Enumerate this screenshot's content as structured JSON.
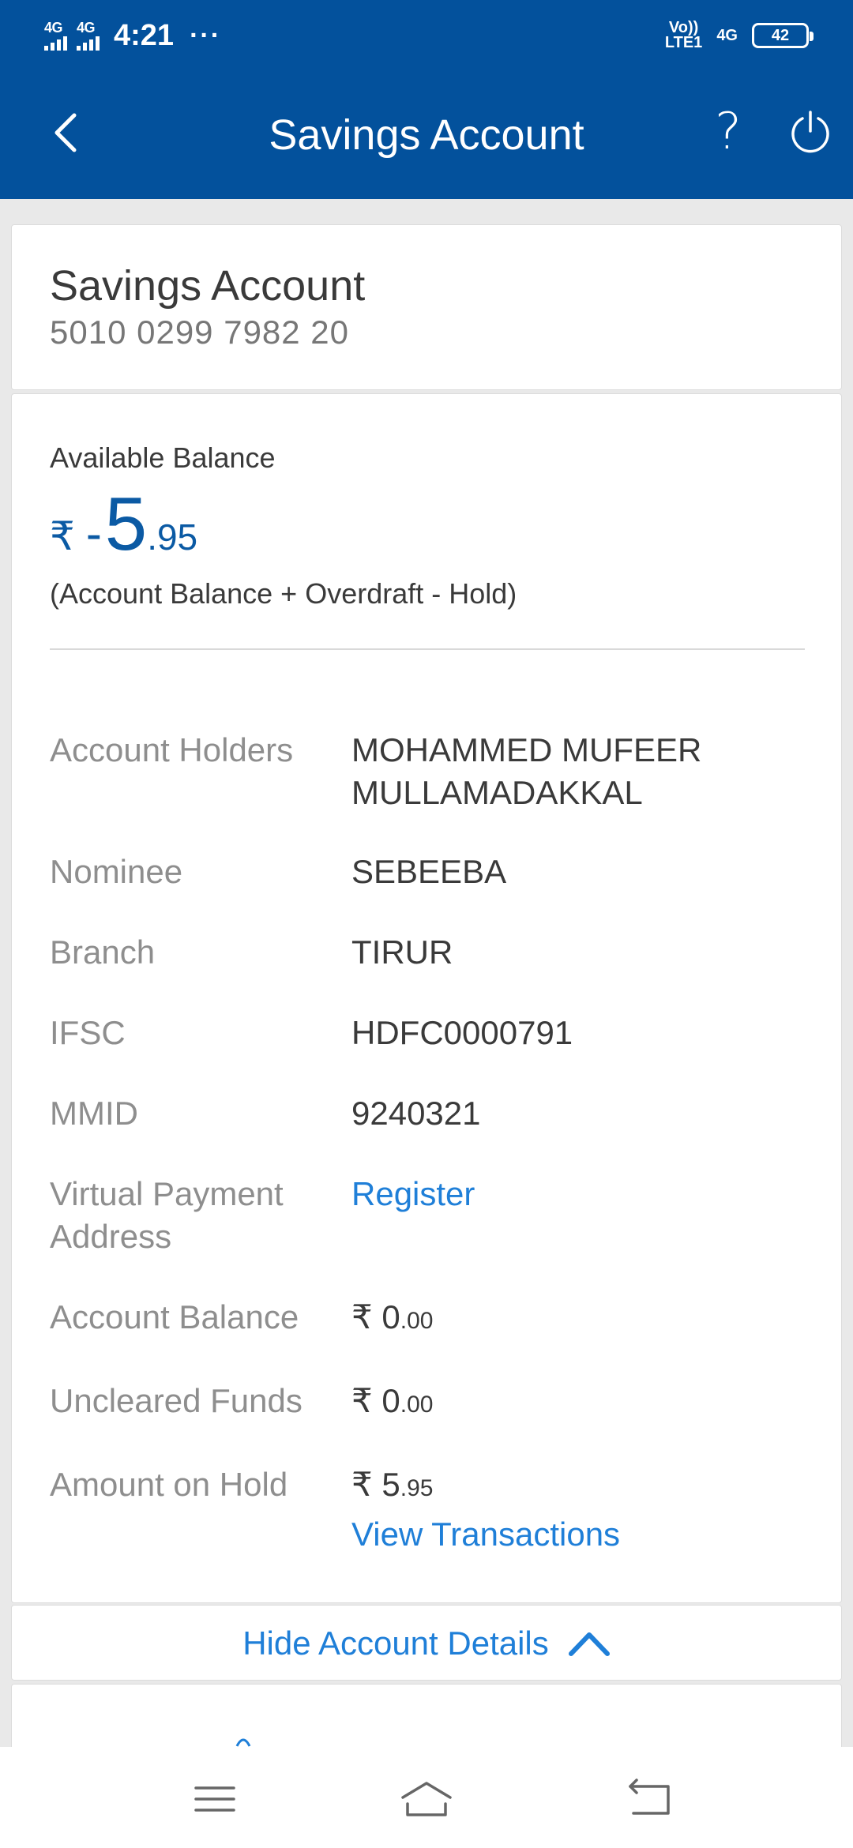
{
  "status_bar": {
    "network_1": "4G",
    "network_2": "4G",
    "time": "4:21",
    "more": "···",
    "volte_top": "Vo))",
    "volte_bottom": "LTE1",
    "network_3": "4G",
    "battery": "42"
  },
  "app_bar": {
    "title": "Savings Account",
    "help": "?",
    "icons": [
      "back-arrow-icon",
      "help-icon",
      "power-icon"
    ]
  },
  "account": {
    "name": "Savings Account",
    "number": "5010 0299 7982 20"
  },
  "balance": {
    "label": "Available Balance",
    "currency": "₹",
    "sign": "-",
    "integer": "5",
    "decimal": ".95",
    "formula": "(Account Balance + Overdraft - Hold)"
  },
  "details": {
    "holders_label": "Account Holders",
    "holders_value_line1": "MOHAMMED MUFEER",
    "holders_value_line2": "MULLAMADAKKAL",
    "nominee_label": "Nominee",
    "nominee_value": "SEBEEBA",
    "branch_label": "Branch",
    "branch_value": "TIRUR",
    "ifsc_label": "IFSC",
    "ifsc_value": "HDFC0000791",
    "mmid_label": "MMID",
    "mmid_value": "9240321",
    "vpa_label_line1": "Virtual Payment",
    "vpa_label_line2": "Address",
    "vpa_value": "Register",
    "acct_balance_label": "Account Balance",
    "acct_balance_cur": "₹",
    "acct_balance_int": "0",
    "acct_balance_dec": ".00",
    "uncleared_label": "Uncleared Funds",
    "uncleared_cur": "₹",
    "uncleared_int": "0",
    "uncleared_dec": ".00",
    "hold_label": "Amount on Hold",
    "hold_cur": "₹",
    "hold_int": "5",
    "hold_dec": ".95",
    "view_transactions": "View Transactions"
  },
  "hide_details": "Hide Account Details",
  "colors": {
    "primary": "#03519c",
    "link": "#1f7fd8",
    "label_gray": "#8e8e8e"
  },
  "nav_bar": [
    "menu-icon",
    "home-icon",
    "back-icon"
  ]
}
